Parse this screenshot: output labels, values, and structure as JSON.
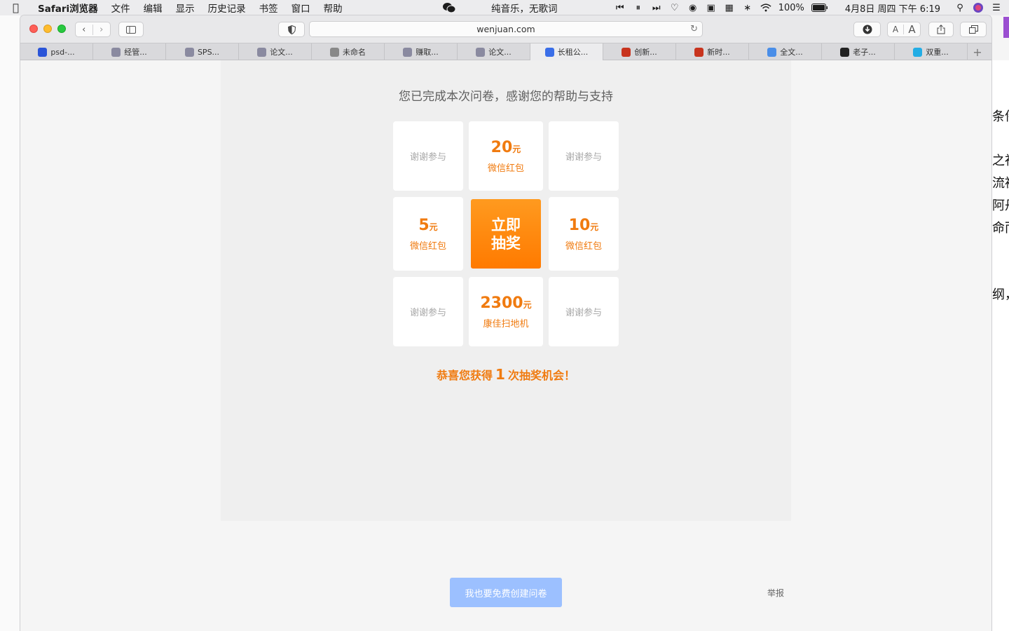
{
  "menubar": {
    "app_name": "Safari浏览器",
    "menus": [
      "文件",
      "编辑",
      "显示",
      "历史记录",
      "书签",
      "窗口",
      "帮助"
    ],
    "now_playing": "纯音乐，无歌词",
    "battery": "100%",
    "datetime": "4月8日 周四 下午 6:19"
  },
  "browser": {
    "url": "wenjuan.com",
    "font_small": "A",
    "font_large": "A",
    "tabs": [
      {
        "label": "psd-...",
        "icon": "paw-icon",
        "color": "#2b55d8"
      },
      {
        "label": "经管...",
        "icon": "p-icon",
        "color": "#8a8aa0"
      },
      {
        "label": "SPS...",
        "icon": "p-icon",
        "color": "#8a8aa0"
      },
      {
        "label": "论文...",
        "icon": "p-icon",
        "color": "#8a8aa0"
      },
      {
        "label": "未命名",
        "icon": "compass-icon",
        "color": "#888888"
      },
      {
        "label": "赚取...",
        "icon": "p-icon",
        "color": "#8a8aa0"
      },
      {
        "label": "论文...",
        "icon": "p-icon",
        "color": "#8a8aa0"
      },
      {
        "label": "长租公...",
        "icon": "flag-icon",
        "color": "#3a6ee8"
      },
      {
        "label": "创新...",
        "icon": "zhi-icon",
        "color": "#c8341e"
      },
      {
        "label": "新时...",
        "icon": "zhi-icon",
        "color": "#c8341e"
      },
      {
        "label": "全文...",
        "icon": "doc-icon",
        "color": "#4a8ee8"
      },
      {
        "label": "老子...",
        "icon": "dao-icon",
        "color": "#222222"
      },
      {
        "label": "双重...",
        "icon": "bili-icon",
        "color": "#23ade5"
      }
    ]
  },
  "survey": {
    "done_message": "您已完成本次问卷，感谢您的帮助与支持",
    "grid": [
      {
        "type": "thanks",
        "text": "谢谢参与"
      },
      {
        "type": "prize",
        "amount": "20",
        "unit": "元",
        "desc": "微信红包"
      },
      {
        "type": "thanks",
        "text": "谢谢参与"
      },
      {
        "type": "prize",
        "amount": "5",
        "unit": "元",
        "desc": "微信红包"
      },
      {
        "type": "button",
        "text": "立即\n抽奖"
      },
      {
        "type": "prize",
        "amount": "10",
        "unit": "元",
        "desc": "微信红包"
      },
      {
        "type": "thanks",
        "text": "谢谢参与"
      },
      {
        "type": "prize",
        "amount": "2300",
        "unit": "元",
        "desc": "康佳扫地机"
      },
      {
        "type": "thanks",
        "text": "谢谢参与"
      }
    ],
    "congrats_prefix": "恭喜您获得",
    "congrats_count": "1",
    "congrats_suffix": "次抽奖机会！",
    "create_button": "我也要免费创建问卷",
    "report_link": "举报"
  },
  "background_window": {
    "lines": [
      "条件",
      "之社",
      "流被",
      "阿丹",
      "命而",
      "纲，"
    ]
  },
  "colors": {
    "accent": "#f07b10",
    "draw_button": "#ff8a0f",
    "create_button": "#9cc0ff"
  }
}
